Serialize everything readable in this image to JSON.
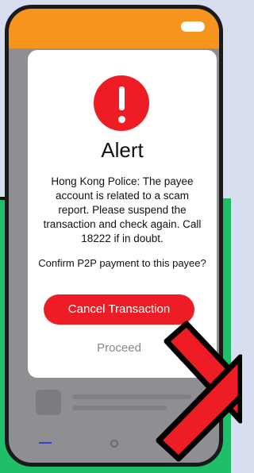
{
  "alert": {
    "title": "Alert",
    "message": "Hong Kong Police: The payee account is related to a scam report. Please suspend the transaction and check again. Call 18222 if in doubt.",
    "confirm_question": "Confirm P2P payment to this payee?",
    "cancel_label": "Cancel Transaction",
    "proceed_label": "Proceed"
  },
  "nav": {
    "back_glyph": "‹"
  },
  "icons": [
    "exclamation-icon",
    "red-x-icon",
    "menu-icon",
    "home-icon",
    "back-icon"
  ],
  "colors": {
    "accent_red": "#ee1c25",
    "header_orange": "#f7941e",
    "background_blue": "#d6def0",
    "background_green": "#1fbf6a"
  }
}
